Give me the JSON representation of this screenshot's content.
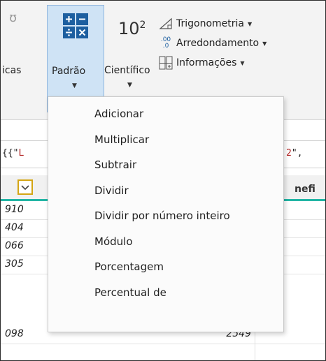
{
  "ribbon": {
    "left_cut_label": "icas",
    "padrao_label": "Padrão",
    "cientifico_label": "Científico",
    "cientifico_icon_text": "10",
    "cientifico_icon_sup": "2",
    "trig_label": "Trigonometria",
    "round_label": "Arredondamento",
    "info_label": "Informações",
    "round_icon_text": ".00",
    "round_icon_sub": ".0"
  },
  "formula_bar": {
    "text_left_prefix": "{{\"",
    "text_left_char": "L",
    "text_right_num": "2",
    "text_right_rest": "\","
  },
  "grid": {
    "header_right_partial": "nefi",
    "rows": [
      {
        "c1": "910",
        "c2": ""
      },
      {
        "c1": "404",
        "c2": ""
      },
      {
        "c1": "066",
        "c2": ""
      },
      {
        "c1": "305",
        "c2": ""
      },
      {
        "c1": "098",
        "c2": "2549"
      }
    ]
  },
  "menu": {
    "items": [
      "Adicionar",
      "Multiplicar",
      "Subtrair",
      "Dividir",
      "Dividir por número inteiro",
      "Módulo",
      "Porcentagem",
      "Percentual de"
    ]
  },
  "colors": {
    "accent_teal": "#23b5a5",
    "padrao_icon_blue": "#1d5fa0",
    "selected_bg": "#cfe3f5",
    "filter_border": "#d4a514"
  }
}
